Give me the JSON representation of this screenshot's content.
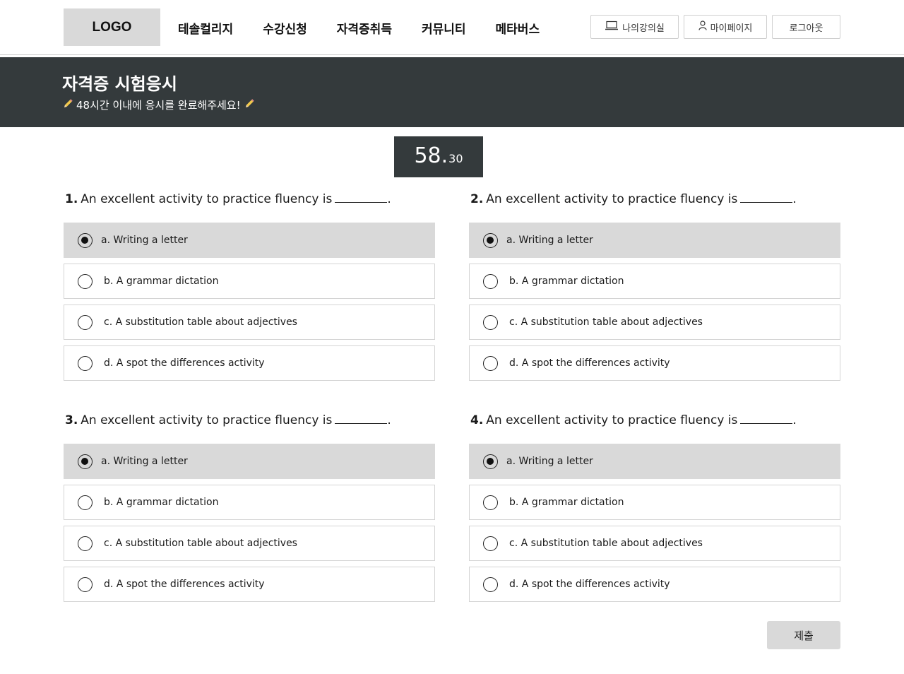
{
  "header": {
    "logo": "LOGO",
    "nav": [
      "테솔컬리지",
      "수강신청",
      "자격증취득",
      "커뮤니티",
      "메타버스"
    ],
    "buttons": {
      "my_classroom": "나의강의실",
      "my_page": "마이페이지",
      "logout": "로그아웃"
    }
  },
  "banner": {
    "title": "자격증 시험응시",
    "subtitle": "48시간 이내에 응시를 완료해주세요!"
  },
  "timer": {
    "main": "58.",
    "fraction": "30"
  },
  "questions": [
    {
      "number": "1.",
      "text": "An excellent activity to practice fluency is",
      "end": ".",
      "options": [
        "a. Writing a letter",
        "b. A grammar dictation",
        "c. A substitution table about adjectives",
        "d. A spot the differences activity"
      ],
      "selected": 0
    },
    {
      "number": "2.",
      "text": "An excellent activity to practice fluency is",
      "end": ".",
      "options": [
        "a. Writing a letter",
        "b. A grammar dictation",
        "c. A substitution table about adjectives",
        "d. A spot the differences activity"
      ],
      "selected": 0
    },
    {
      "number": "3.",
      "text": "An excellent activity to practice fluency is",
      "end": ".",
      "options": [
        "a. Writing a letter",
        "b. A grammar dictation",
        "c. A substitution table about adjectives",
        "d. A spot the differences activity"
      ],
      "selected": 0
    },
    {
      "number": "4.",
      "text": "An excellent activity to practice fluency is",
      "end": ".",
      "options": [
        "a. Writing a letter",
        "b. A grammar dictation",
        "c. A substitution table about adjectives",
        "d. A spot the differences activity"
      ],
      "selected": 0
    }
  ],
  "submit": "제출",
  "icons": {
    "classroom": "laptop-icon",
    "mypage": "user-icon",
    "banner_deco": "pencil-icon"
  },
  "colors": {
    "banner_bg": "#343a3c",
    "selected_option_bg": "#d9d9d9",
    "logo_bg": "#d9d9d9"
  }
}
